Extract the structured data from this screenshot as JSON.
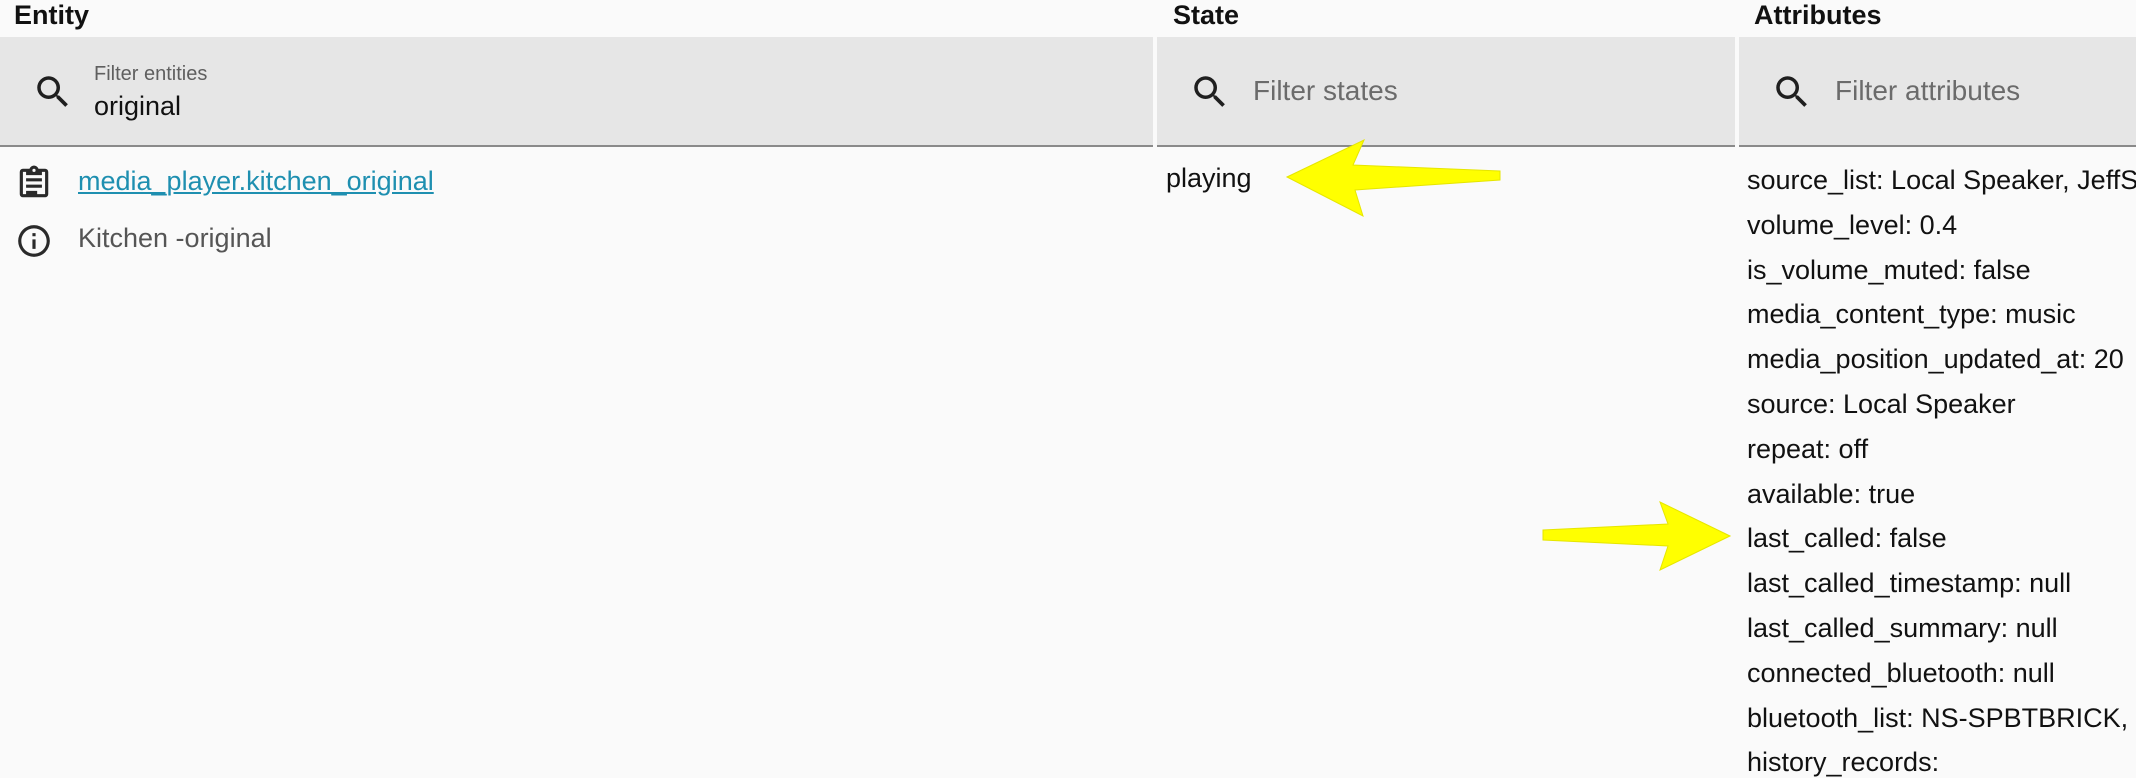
{
  "columns": {
    "entity": "Entity",
    "state": "State",
    "attributes": "Attributes"
  },
  "filters": {
    "entity": {
      "label": "Filter entities",
      "value": "original",
      "icon": "search-icon"
    },
    "state": {
      "placeholder": "Filter states",
      "icon": "search-icon"
    },
    "attributes": {
      "placeholder": "Filter attributes",
      "icon": "search-icon"
    }
  },
  "row": {
    "entity_id": "media_player.kitchen_original",
    "entity_icon": "clipboard-icon",
    "friendly_name": "Kitchen -original",
    "info_icon": "info-icon",
    "state": "playing",
    "attributes": [
      "source_list: Local Speaker, JeffS",
      "volume_level: 0.4",
      "is_volume_muted: false",
      "media_content_type: music",
      "media_position_updated_at: 20",
      "source: Local Speaker",
      "repeat: off",
      "available: true",
      "last_called: false",
      "last_called_timestamp: null",
      "last_called_summary: null",
      "connected_bluetooth: null",
      "bluetooth_list: NS-SPBTBRICK, J",
      "history_records:"
    ]
  },
  "annotations": {
    "arrow_color": "#ffff00",
    "accent_link": "#1e8fb0"
  }
}
